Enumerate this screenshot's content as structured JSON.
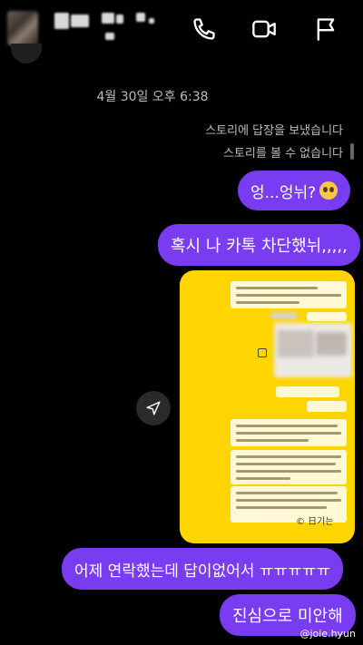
{
  "header": {
    "icons": [
      "phone-icon",
      "video-icon",
      "flag-icon"
    ]
  },
  "thread": {
    "date": "4월 30일 오후 6:38",
    "system_messages": [
      "스토리에 답장을 보냈습니다",
      "스토리를 볼 수 없습니다"
    ],
    "messages": [
      {
        "text": "엉...엉뉘?",
        "emoji": "pleading-face"
      },
      {
        "text": "혹시 나 카톡 차단했뉘,,,,,"
      },
      {
        "text": "어제 연락했는데 답이없어서 ㅠㅠㅠㅠㅠ"
      },
      {
        "text": "진심으로 미안해"
      }
    ]
  },
  "shared_image": {
    "watermark": "© 日기는"
  },
  "watermark_handle": "@joie.hyun",
  "colors": {
    "bubble": "#7a3cf0",
    "kakao_yellow": "#ffd500",
    "background": "#000000"
  }
}
